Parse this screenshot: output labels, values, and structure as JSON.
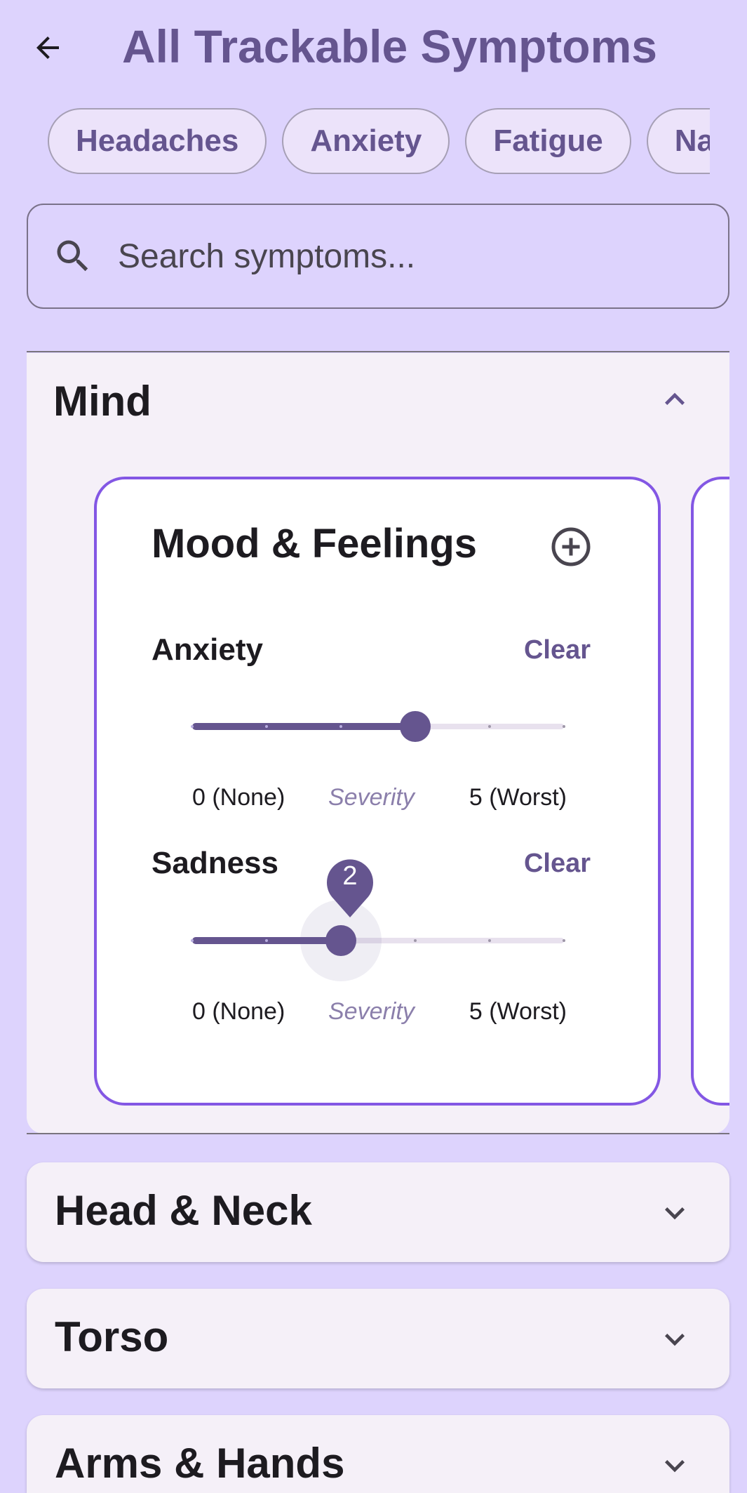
{
  "header": {
    "title": "All Trackable Symptoms",
    "back_icon": "arrow-left-icon"
  },
  "chips": [
    "Headaches",
    "Anxiety",
    "Fatigue",
    "Nausea"
  ],
  "search": {
    "placeholder": "Search symptoms...",
    "value": "",
    "icon": "search-icon"
  },
  "sections": {
    "mind": {
      "title": "Mind",
      "expanded": true,
      "card": {
        "title": "Mood & Feelings",
        "symptoms": [
          {
            "label": "Anxiety",
            "clear_label": "Clear",
            "value": 3,
            "min_label": "0 (None)",
            "mid_label": "Severity",
            "max_label": "5 (Worst)"
          },
          {
            "label": "Sadness",
            "clear_label": "Clear",
            "value": 2,
            "value_label": "2",
            "min_label": "0 (None)",
            "mid_label": "Severity",
            "max_label": "5 (Worst)"
          }
        ]
      }
    },
    "head_neck": {
      "title": "Head & Neck",
      "expanded": false
    },
    "torso": {
      "title": "Torso",
      "expanded": false
    },
    "arms_hands": {
      "title": "Arms & Hands",
      "expanded": false
    }
  },
  "colors": {
    "background": "#ddd3fd",
    "primary": "#65558f",
    "card_border": "#8357e4",
    "surface": "#f5f0f8"
  }
}
